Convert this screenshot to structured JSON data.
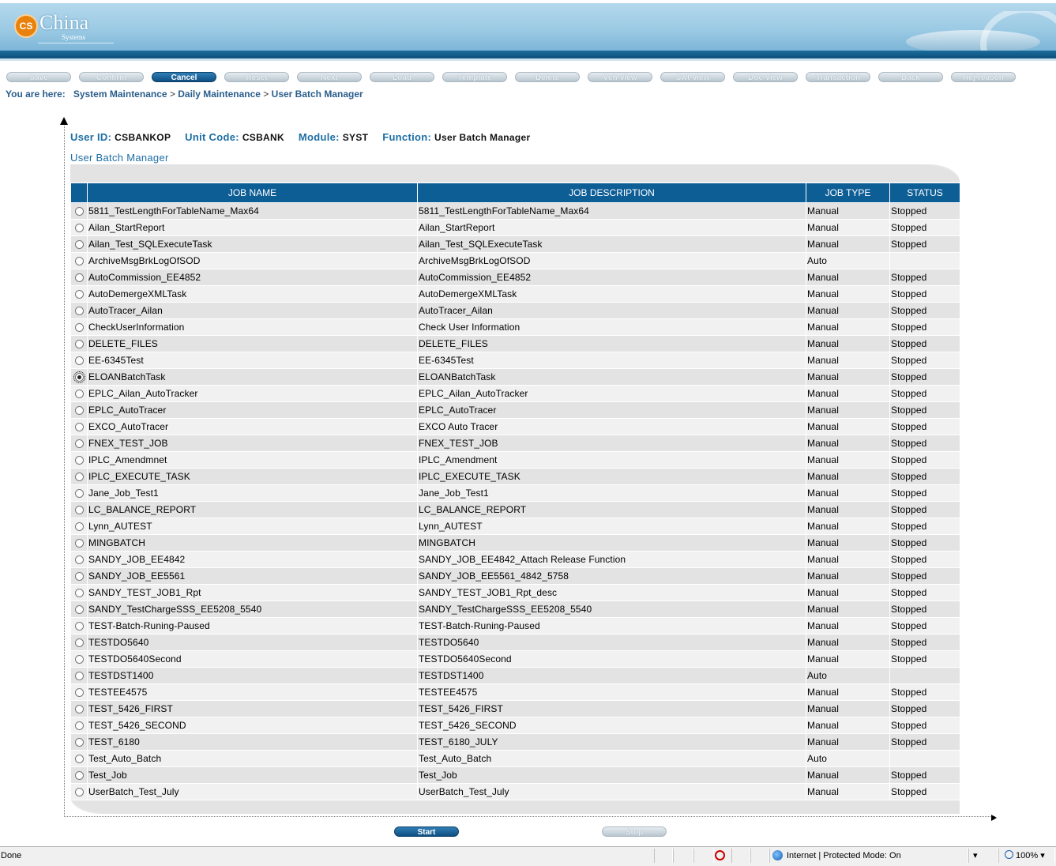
{
  "brand": {
    "name": "China",
    "sub": "Systems",
    "badge": "CS"
  },
  "toolbar": [
    "Save",
    "Confirm",
    "Cancel",
    "Reset",
    "Next",
    "Load",
    "Template",
    "Delete",
    "Vch-view",
    "Swt-view",
    "Doc-view",
    "Transaction",
    "Back",
    "Rej-reason"
  ],
  "toolbar_active": "Cancel",
  "breadcrumb": {
    "prefix": "You are here:",
    "items": [
      "System Maintenance",
      "Daily Maintenance",
      "User Batch Manager"
    ],
    "sep": ">"
  },
  "info": {
    "user_id_label": "User ID:",
    "user_id": "CSBANKOP",
    "unit_code_label": "Unit Code:",
    "unit_code": "CSBANK",
    "module_label": "Module:",
    "module": "SYST",
    "function_label": "Function:",
    "function": "User Batch Manager"
  },
  "subtitle": "User Batch Manager",
  "table": {
    "headers": [
      "JOB NAME",
      "JOB DESCRIPTION",
      "JOB TYPE",
      "STATUS"
    ],
    "selected_index": 10,
    "rows": [
      [
        "5811_TestLengthForTableName_Max64",
        "5811_TestLengthForTableName_Max64",
        "Manual",
        "Stopped"
      ],
      [
        "Ailan_StartReport",
        "Ailan_StartReport",
        "Manual",
        "Stopped"
      ],
      [
        "Ailan_Test_SQLExecuteTask",
        "Ailan_Test_SQLExecuteTask",
        "Manual",
        "Stopped"
      ],
      [
        "ArchiveMsgBrkLogOfSOD",
        "ArchiveMsgBrkLogOfSOD",
        "Auto",
        ""
      ],
      [
        "AutoCommission_EE4852",
        "AutoCommission_EE4852",
        "Manual",
        "Stopped"
      ],
      [
        "AutoDemergeXMLTask",
        "AutoDemergeXMLTask",
        "Manual",
        "Stopped"
      ],
      [
        "AutoTracer_Ailan",
        "AutoTracer_Ailan",
        "Manual",
        "Stopped"
      ],
      [
        "CheckUserInformation",
        "Check User Information",
        "Manual",
        "Stopped"
      ],
      [
        "DELETE_FILES",
        "DELETE_FILES",
        "Manual",
        "Stopped"
      ],
      [
        "EE-6345Test",
        "EE-6345Test",
        "Manual",
        "Stopped"
      ],
      [
        "ELOANBatchTask",
        "ELOANBatchTask",
        "Manual",
        "Stopped"
      ],
      [
        "EPLC_Ailan_AutoTracker",
        "EPLC_Ailan_AutoTracker",
        "Manual",
        "Stopped"
      ],
      [
        "EPLC_AutoTracer",
        "EPLC_AutoTracer",
        "Manual",
        "Stopped"
      ],
      [
        "EXCO_AutoTracer",
        "EXCO Auto Tracer",
        "Manual",
        "Stopped"
      ],
      [
        "FNEX_TEST_JOB",
        "FNEX_TEST_JOB",
        "Manual",
        "Stopped"
      ],
      [
        "IPLC_Amendmnet",
        "IPLC_Amendment",
        "Manual",
        "Stopped"
      ],
      [
        "IPLC_EXECUTE_TASK",
        "IPLC_EXECUTE_TASK",
        "Manual",
        "Stopped"
      ],
      [
        "Jane_Job_Test1",
        "Jane_Job_Test1",
        "Manual",
        "Stopped"
      ],
      [
        "LC_BALANCE_REPORT",
        "LC_BALANCE_REPORT",
        "Manual",
        "Stopped"
      ],
      [
        "Lynn_AUTEST",
        "Lynn_AUTEST",
        "Manual",
        "Stopped"
      ],
      [
        "MINGBATCH",
        "MINGBATCH",
        "Manual",
        "Stopped"
      ],
      [
        "SANDY_JOB_EE4842",
        "SANDY_JOB_EE4842_Attach Release Function",
        "Manual",
        "Stopped"
      ],
      [
        "SANDY_JOB_EE5561",
        "SANDY_JOB_EE5561_4842_5758",
        "Manual",
        "Stopped"
      ],
      [
        "SANDY_TEST_JOB1_Rpt",
        "SANDY_TEST_JOB1_Rpt_desc",
        "Manual",
        "Stopped"
      ],
      [
        "SANDY_TestChargeSSS_EE5208_5540",
        "SANDY_TestChargeSSS_EE5208_5540",
        "Manual",
        "Stopped"
      ],
      [
        "TEST-Batch-Runing-Paused",
        "TEST-Batch-Runing-Paused",
        "Manual",
        "Stopped"
      ],
      [
        "TESTDO5640",
        "TESTDO5640",
        "Manual",
        "Stopped"
      ],
      [
        "TESTDO5640Second",
        "TESTDO5640Second",
        "Manual",
        "Stopped"
      ],
      [
        "TESTDST1400",
        "TESTDST1400",
        "Auto",
        ""
      ],
      [
        "TESTEE4575",
        "TESTEE4575",
        "Manual",
        "Stopped"
      ],
      [
        "TEST_5426_FIRST",
        "TEST_5426_FIRST",
        "Manual",
        "Stopped"
      ],
      [
        "TEST_5426_SECOND",
        "TEST_5426_SECOND",
        "Manual",
        "Stopped"
      ],
      [
        "TEST_6180",
        "TEST_6180_JULY",
        "Manual",
        "Stopped"
      ],
      [
        "Test_Auto_Batch",
        "Test_Auto_Batch",
        "Auto",
        ""
      ],
      [
        "Test_Job",
        "Test_Job",
        "Manual",
        "Stopped"
      ],
      [
        "UserBatch_Test_July",
        "UserBatch_Test_July",
        "Manual",
        "Stopped"
      ]
    ]
  },
  "actions": {
    "start": "Start",
    "stop": "Stop"
  },
  "statusbar": {
    "status": "Done",
    "zone": "Internet | Protected Mode: On",
    "zoom": "100%"
  }
}
